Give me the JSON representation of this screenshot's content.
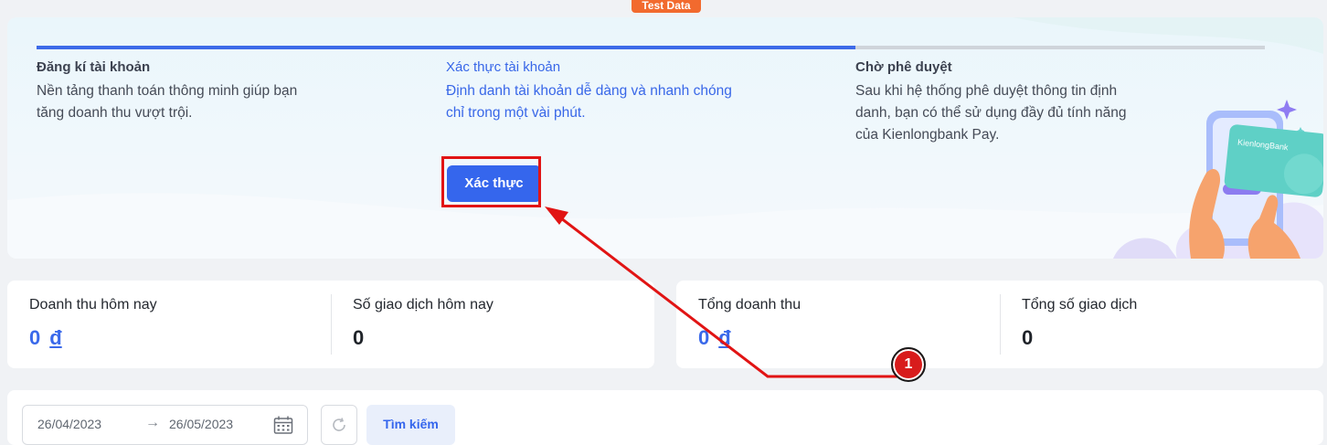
{
  "badge": "Test Data",
  "steps": [
    {
      "title": "Đăng kí tài khoản",
      "desc_line1": "Nền tảng thanh toán thông minh giúp bạn",
      "desc_line2": "tăng doanh thu vượt trội."
    },
    {
      "title": "Xác thực tài khoản",
      "desc_line1": "Định danh tài khoản dễ dàng và nhanh chóng",
      "desc_line2": "chỉ trong một vài phút."
    },
    {
      "title": "Chờ phê duyệt",
      "desc_line1": "Sau khi hệ thống phê duyệt thông tin định",
      "desc_line2": "danh, bạn có thể sử dụng đầy đủ tính năng",
      "desc_line3": "của Kienlongbank Pay."
    }
  ],
  "verify_button": "Xác thực",
  "card_brand": "KienlongBank",
  "stats": [
    {
      "label": "Doanh thu hôm nay",
      "value": "0",
      "currency": "đ"
    },
    {
      "label": "Số giao dịch hôm nay",
      "value": "0"
    },
    {
      "label": "Tổng doanh thu",
      "value": "0",
      "currency": "đ"
    },
    {
      "label": "Tổng số giao dịch",
      "value": "0"
    }
  ],
  "search": {
    "date_from": "26/04/2023",
    "date_to": "26/05/2023",
    "search_button": "Tìm kiếm"
  },
  "annotation_number": "1",
  "colors": {
    "primary": "#3566ed",
    "highlight": "#e11414",
    "badge": "#f26a2e"
  }
}
